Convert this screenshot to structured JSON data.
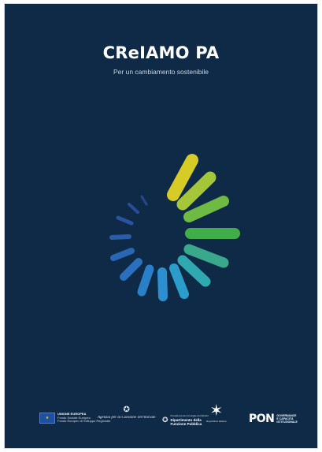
{
  "cover": {
    "title": "CReIAMO PA",
    "subtitle": "Per un cambiamento sostenibile"
  },
  "colors": {
    "background": "#0e2a47",
    "title": "#ffffff",
    "logo_yellow": "#f7d21e",
    "logo_green": "#3fae49",
    "logo_teal": "#2fa8b0",
    "logo_blue": "#2c7ec6",
    "logo_dark_blue": "#26549e"
  },
  "footer_logos": {
    "eu": {
      "icon": "eu-flag-icon",
      "name": "UNIONE EUROPEA",
      "line1": "Fondo Sociale Europeo",
      "line2": "Fondo Europeo di Sviluppo Regionale"
    },
    "agency": {
      "icon": "italian-emblem-icon",
      "name": "Agenzia per la Coesione Territoriale"
    },
    "department": {
      "icon": "italian-emblem-icon",
      "line1": "Presidenza del Consiglio dei Ministri",
      "name": "Dipartimento della",
      "name2": "Funzione Pubblica"
    },
    "star": {
      "icon": "star-icon",
      "name": "Repubblica Italiana"
    },
    "pon": {
      "mark": "PON",
      "line1": "GOVERNANCE",
      "line2": "E CAPACITÀ",
      "line3": "ISTITUZIONALE"
    }
  }
}
